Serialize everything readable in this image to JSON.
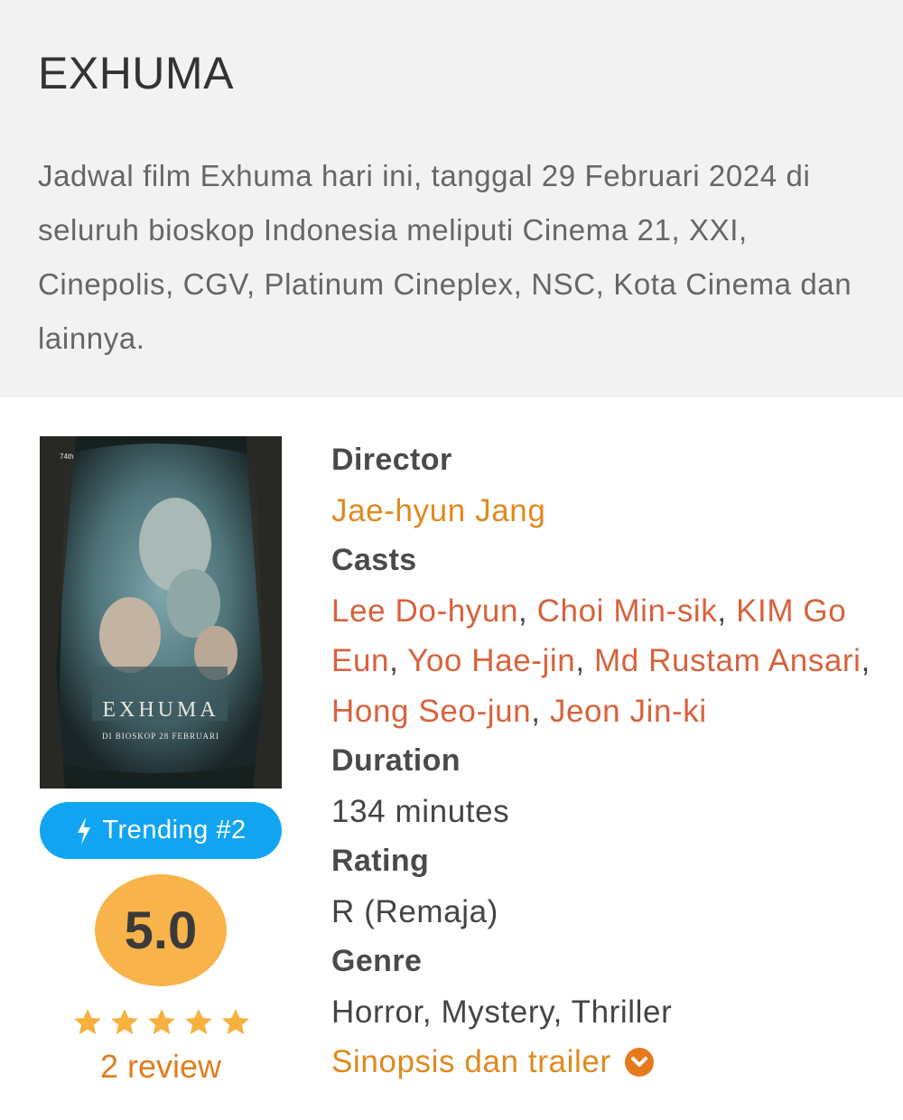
{
  "header": {
    "title": "EXHUMA",
    "intro": "Jadwal film Exhuma hari ini, tanggal 29 Februari 2024 di seluruh bioskop Indonesia meliputi Cinema 21, XXI, Cinepolis, CGV, Platinum Cineplex, NSC, Kota Cinema dan lainnya."
  },
  "poster": {
    "title_text": "EXHUMA",
    "tagline": "DI BIOSKOP 28 FEBRUARI",
    "badge": "74th"
  },
  "trending": {
    "label": "Trending #2",
    "icon": "bolt-icon"
  },
  "score": {
    "value": "5.0",
    "stars": 5
  },
  "reviews": {
    "label": "2 review"
  },
  "details": {
    "director_label": "Director",
    "director": "Jae-hyun Jang",
    "casts_label": "Casts",
    "casts": [
      "Lee Do-hyun",
      "Choi Min-sik",
      "KIM Go Eun",
      "Yoo Hae-jin",
      "Md Rustam Ansari",
      "Hong Seo-jun",
      "Jeon Jin-ki"
    ],
    "duration_label": "Duration",
    "duration": "134 minutes",
    "rating_label": "Rating",
    "rating": "R (Remaja)",
    "genre_label": "Genre",
    "genre": "Horror, Mystery, Thriller",
    "synopsis_label": "Sinopsis dan trailer"
  },
  "colors": {
    "trending": "#11a5f1",
    "score": "#f8b34a",
    "accent": "#e08a1e",
    "cast": "#d8623c"
  }
}
